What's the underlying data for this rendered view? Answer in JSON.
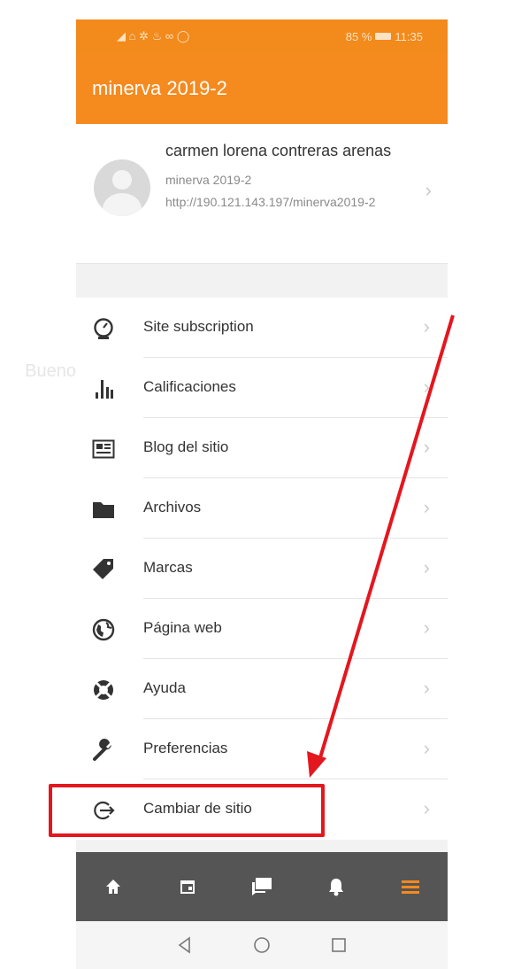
{
  "background": {
    "ghost_text": "Bueno"
  },
  "status_bar": {
    "left_icons": "◢ ⌂ ✲ ♨ ∞ ◯",
    "battery": "85 %",
    "time": "11:35"
  },
  "app_bar": {
    "title": "minerva 2019-2"
  },
  "account": {
    "name": "carmen lorena contreras arenas",
    "site": "minerva 2019-2",
    "url": "http://190.121.143.197/minerva2019-2"
  },
  "menu": {
    "items": [
      {
        "label": "Site subscription",
        "icon": "gauge-icon"
      },
      {
        "label": "Calificaciones",
        "icon": "bar-chart-icon"
      },
      {
        "label": "Blog del sitio",
        "icon": "newspaper-icon"
      },
      {
        "label": "Archivos",
        "icon": "folder-icon"
      },
      {
        "label": "Marcas",
        "icon": "tag-icon"
      },
      {
        "label": "Página web",
        "icon": "globe-icon"
      },
      {
        "label": "Ayuda",
        "icon": "lifebuoy-icon"
      },
      {
        "label": "Preferencias",
        "icon": "wrench-icon"
      },
      {
        "label": "Cambiar de sitio",
        "icon": "sign-out-icon"
      }
    ]
  },
  "tabbar": {
    "items": [
      "home-icon",
      "calendar-icon",
      "messages-icon",
      "bell-icon",
      "menu-icon"
    ],
    "active": "menu-icon"
  },
  "colors": {
    "brand": "#f58a1f",
    "highlight": "#e4161e",
    "tabbar": "#555555"
  }
}
